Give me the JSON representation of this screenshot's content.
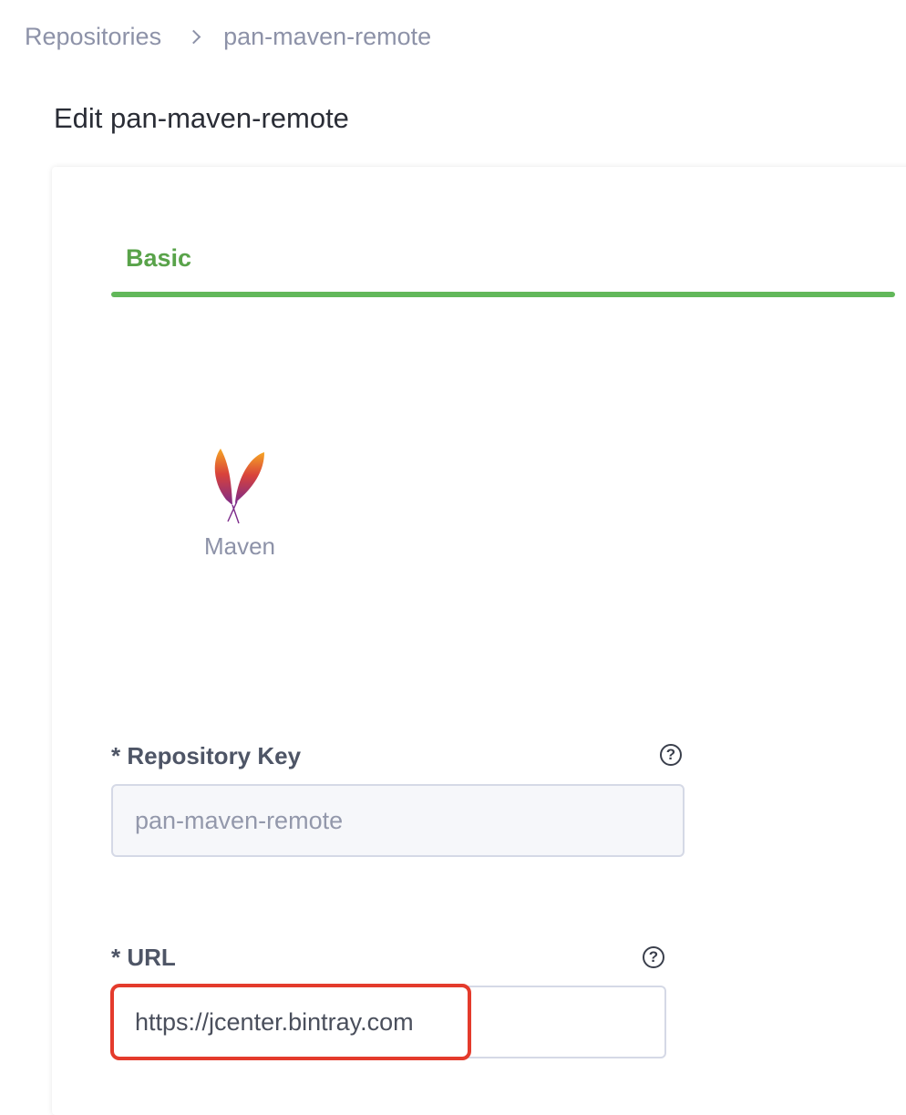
{
  "breadcrumb": {
    "parent": "Repositories",
    "current": "pan-maven-remote"
  },
  "page": {
    "title": "Edit pan-maven-remote"
  },
  "tabs": {
    "basic_label": "Basic"
  },
  "package_type": {
    "label": "Maven",
    "icon": "apache-feather-icon"
  },
  "form": {
    "repository_key": {
      "label": "* Repository Key",
      "value": "pan-maven-remote"
    },
    "url": {
      "label": "* URL",
      "value": "https://jcenter.bintray.com"
    }
  },
  "colors": {
    "accent_green": "#62b85a",
    "highlight_red": "#e43b2c"
  }
}
